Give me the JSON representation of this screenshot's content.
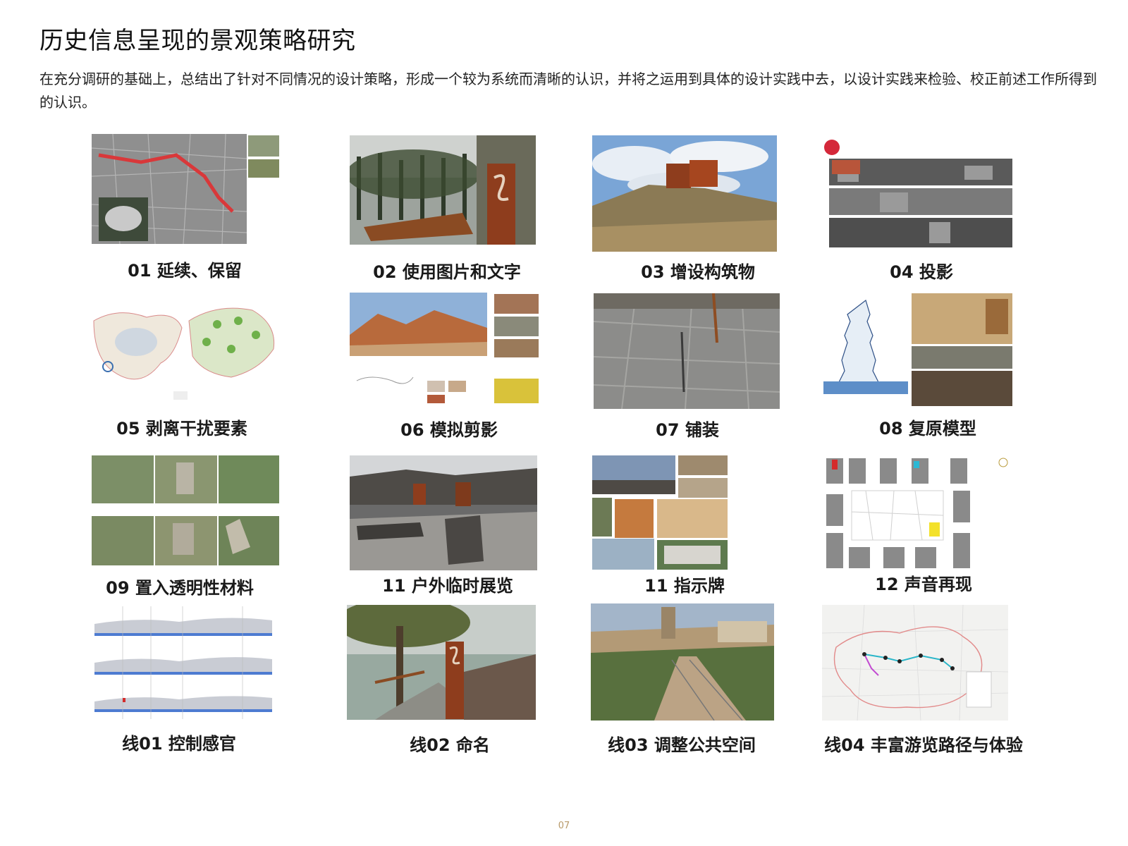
{
  "title": "历史信息呈现的景观策略研究",
  "intro": "在充分调研的基础上，总结出了针对不同情况的设计策略，形成一个较为系统而清晰的认识，并将之运用到具体的设计实践中去，以设计实践来检验、校正前述工作所得到的认识。",
  "strategies": [
    {
      "caption": "01  延续、保留",
      "image": "aerial-map-with-red-route"
    },
    {
      "caption": "02  使用图片和文字",
      "image": "forest-rusted-steel-sign"
    },
    {
      "caption": "03  增设构筑物",
      "image": "rusted-box-on-rocks"
    },
    {
      "caption": "04  投影",
      "image": "street-photo-collage"
    },
    {
      "caption": "05  剥离干扰要素",
      "image": "site-plan-drawings"
    },
    {
      "caption": "06  模拟剪影",
      "image": "desert-silhouette-panel"
    },
    {
      "caption": "07  铺装",
      "image": "stone-paving"
    },
    {
      "caption": "08  复原模型",
      "image": "pagoda-section-and-paintings"
    },
    {
      "caption": "09  置入透明性材料",
      "image": "ruin-photo-series"
    },
    {
      "caption": "11   户外临时展览",
      "image": "stone-walls-outdoor"
    },
    {
      "caption": "11  指示牌",
      "image": "signboard-photos"
    },
    {
      "caption": "12  声音再现",
      "image": "street-map-sound"
    },
    {
      "caption": "线01  控制感官",
      "image": "section-profiles"
    },
    {
      "caption": "线02  命名",
      "image": "tree-and-rusted-sign"
    },
    {
      "caption": "线03  调整公共空间",
      "image": "boardwalk-town"
    },
    {
      "caption": "线04 丰富游览路径与体验",
      "image": "route-map"
    }
  ],
  "page_number": "07"
}
